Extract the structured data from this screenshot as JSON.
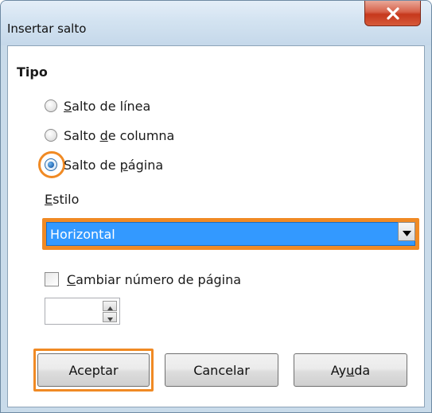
{
  "window": {
    "title": "Insertar salto",
    "close_glyph": "X"
  },
  "tipo": {
    "heading": "Tipo",
    "options": [
      {
        "label_pre": "",
        "mnemonic": "S",
        "label_post": "alto de línea",
        "checked": false
      },
      {
        "label_pre": "Salto ",
        "mnemonic": "d",
        "label_post": "e columna",
        "checked": false
      },
      {
        "label_pre": "Salto de ",
        "mnemonic": "p",
        "label_post": "ágina",
        "checked": true
      }
    ]
  },
  "estilo": {
    "label_mnemonic": "E",
    "label_post": "stilo",
    "selected": "Horizontal"
  },
  "page_number": {
    "checkbox_mnemonic": "C",
    "checkbox_post": "ambiar número de página",
    "checked": false,
    "value": ""
  },
  "buttons": {
    "accept": "Aceptar",
    "cancel": "Cancelar",
    "help_pre": "Ay",
    "help_mnemonic": "u",
    "help_post": "da"
  },
  "colors": {
    "focus_accent": "#f08a24",
    "selection": "#3399ff"
  },
  "icons": {
    "close": "close-icon",
    "dropdown": "chevron-down-icon",
    "spin_up": "chevron-up-icon",
    "spin_down": "chevron-down-icon"
  }
}
